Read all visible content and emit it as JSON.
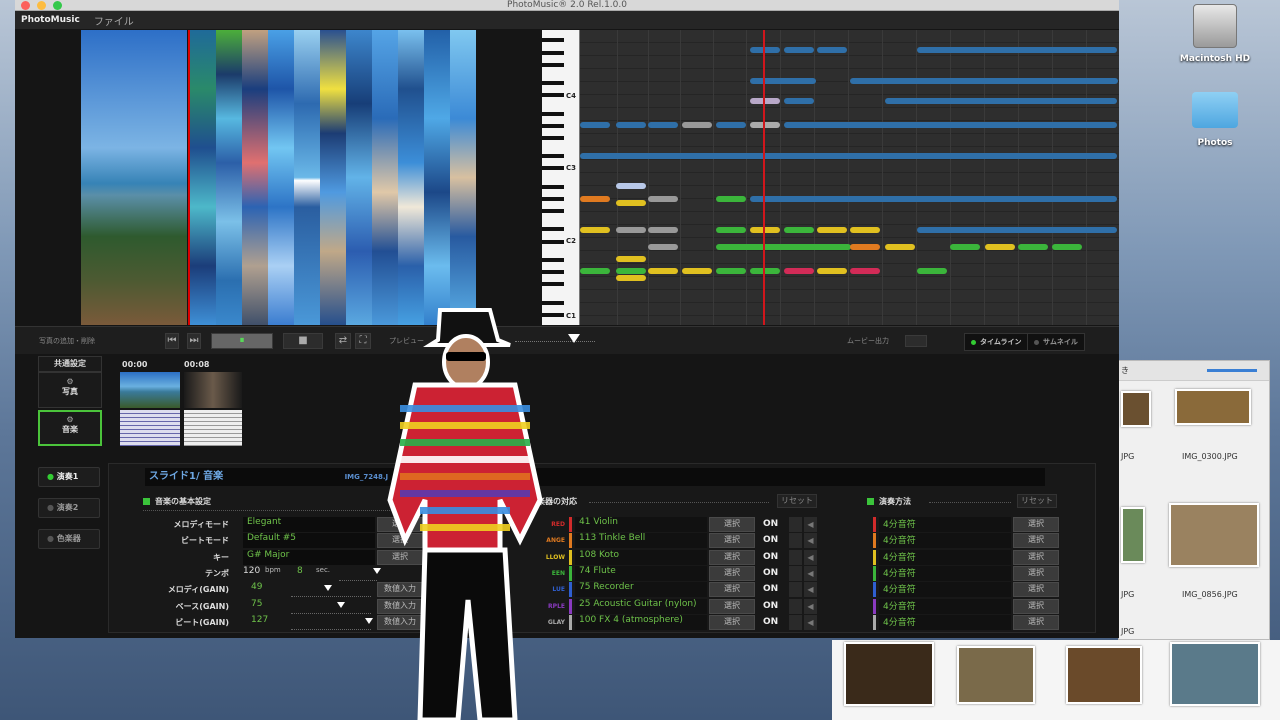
{
  "window": {
    "title": "PhotoMusic® 2.0  Rel.1.0.0"
  },
  "menubar": {
    "brand": "PhotoMusic",
    "file_menu": "ファイル"
  },
  "desktop": {
    "items": [
      {
        "label": "Macintosh HD",
        "icon": "hard-drive-icon"
      },
      {
        "label": "Photos",
        "icon": "folder-icon"
      }
    ]
  },
  "finder": {
    "partial_label": "き",
    "files": [
      "JPG",
      "IMG_0300.JPG",
      "JPG",
      "IMG_0856.JPG",
      "JPG"
    ]
  },
  "piano_roll": {
    "octave_labels": [
      "C4",
      "C3",
      "C2",
      "C1"
    ]
  },
  "controls": {
    "add_label": "写真の追加・削除",
    "preview_label": "プレビュー",
    "movie_label": "ムービー出力",
    "prev_icon": "⏮",
    "next_icon": "⏭",
    "play_icon": "⏸",
    "stop_icon": "■",
    "loop_icon": "⇄",
    "fullscreen_icon": "⛶",
    "view_timeline": "タイムライン",
    "view_thumbnail": "サムネイル"
  },
  "timeline": {
    "common": "共通設定",
    "photo_label": "写真",
    "music_label": "音楽",
    "times": [
      "00:00",
      "00:08"
    ]
  },
  "sidebar": {
    "items": [
      "演奏1",
      "演奏2",
      "色楽器"
    ]
  },
  "panel": {
    "title": "スライド1/ 音楽",
    "image_name": "IMG_7248.J",
    "basic": {
      "header": "音楽の基本設定",
      "rows": [
        {
          "label": "メロディモード",
          "value": "Elegant",
          "button": "選択"
        },
        {
          "label": "ビートモード",
          "value": "Default #5",
          "button": "選択"
        },
        {
          "label": "キー",
          "value": "G# Major",
          "button": "選択"
        }
      ],
      "tempo_label": "テンポ",
      "tempo_value": "120",
      "tempo_unit": "bpm",
      "sec_value": "8",
      "sec_unit": "sec.",
      "gains": [
        {
          "label": "メロディ(GAIN)",
          "value": "49",
          "button": "数値入力",
          "level": 0.45
        },
        {
          "label": "ベース(GAIN)",
          "value": "75",
          "button": "数値入力",
          "level": 0.62
        },
        {
          "label": "ビート(GAIN)",
          "value": "127",
          "button": "数値入力",
          "level": 1.0
        }
      ]
    },
    "instruments": {
      "header": "と楽器の対応",
      "reset": "リセット",
      "rows": [
        {
          "color_label": "RED",
          "color": "#d22b2b",
          "name": "41 Violin",
          "button": "選択",
          "state": "ON"
        },
        {
          "color_label": "ANGE",
          "color": "#e07a20",
          "name": "113 Tinkle Bell",
          "button": "選択",
          "state": "ON"
        },
        {
          "color_label": "LLOW",
          "color": "#e0c020",
          "name": "108 Koto",
          "button": "選択",
          "state": "ON"
        },
        {
          "color_label": "EEN",
          "color": "#3bb53b",
          "name": "74 Flute",
          "button": "選択",
          "state": "ON"
        },
        {
          "color_label": "LUE",
          "color": "#2f5fd0",
          "name": "75 Recorder",
          "button": "選択",
          "state": "ON"
        },
        {
          "color_label": "RPLE",
          "color": "#8a3ac0",
          "name": "25 Acoustic Guitar (nylon)",
          "button": "選択",
          "state": "ON"
        },
        {
          "color_label": "GLAY",
          "color": "#aaaaaa",
          "name": "100 FX 4 (atmosphere)",
          "button": "選択",
          "state": "ON"
        }
      ]
    },
    "playing": {
      "header": "演奏方法",
      "reset": "リセット",
      "rows": [
        "4分音符",
        "4分音符",
        "4分音符",
        "4分音符",
        "4分音符",
        "4分音符",
        "4分音符"
      ],
      "button": "選択"
    }
  }
}
